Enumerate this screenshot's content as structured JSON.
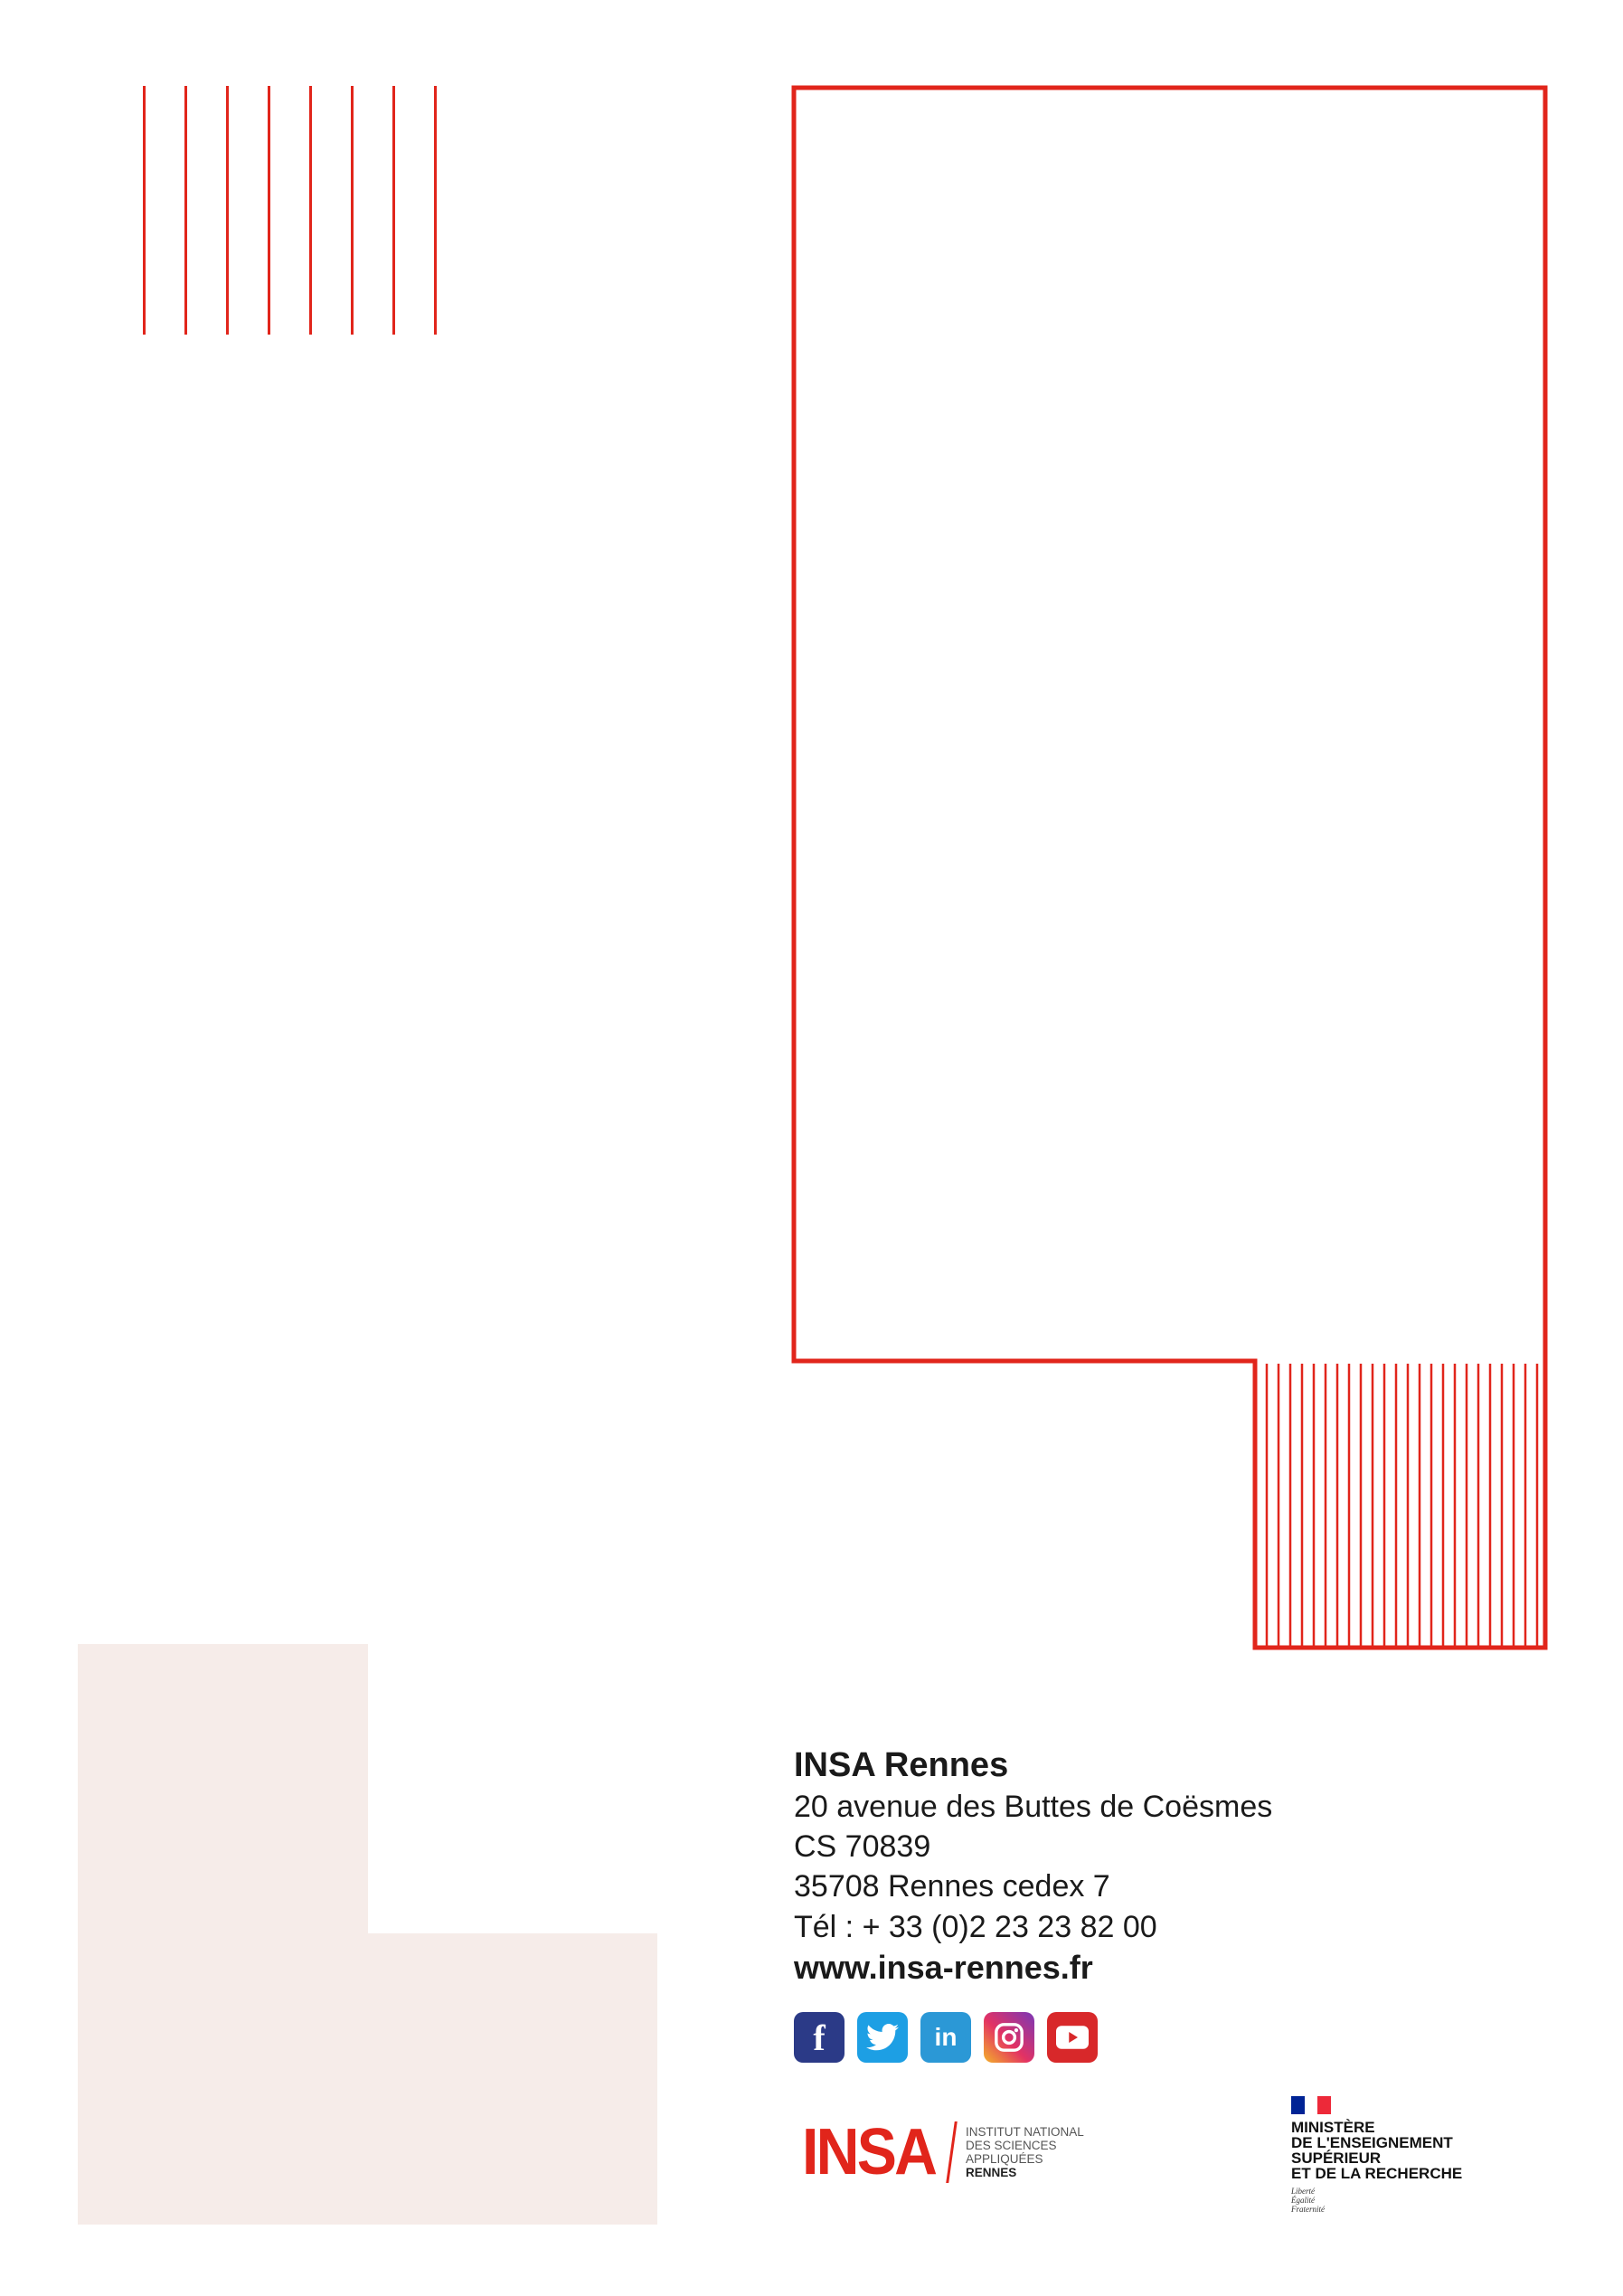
{
  "address": {
    "organization": "INSA Rennes",
    "street": "20 avenue des Buttes de Coësmes",
    "cs": "CS 70839",
    "city": "35708 Rennes cedex 7",
    "phone": "Tél : + 33 (0)2 23 23 82 00",
    "website": "www.insa-rennes.fr"
  },
  "social": [
    {
      "name": "facebook-icon",
      "glyph": "f"
    },
    {
      "name": "twitter-icon",
      "glyph": "🐦"
    },
    {
      "name": "linkedin-icon",
      "glyph": "in"
    },
    {
      "name": "instagram-icon",
      "glyph": "◎"
    },
    {
      "name": "youtube-icon",
      "glyph": "▶"
    }
  ],
  "insa_logo": {
    "word": "INSA",
    "lines": [
      "INSTITUT NATIONAL",
      "DES SCIENCES",
      "APPLIQUÉES",
      "RENNES"
    ]
  },
  "ministry": {
    "lines": [
      "MINISTÈRE",
      "DE L'ENSEIGNEMENT",
      "SUPÉRIEUR",
      "ET DE LA RECHERCHE"
    ],
    "motto": [
      "Liberté",
      "Égalité",
      "Fraternité"
    ]
  },
  "colors": {
    "accent": "#e1251b",
    "beige": "#f6ece9",
    "flag_blue": "#002395",
    "flag_white": "#ffffff",
    "flag_red": "#ed2939"
  }
}
